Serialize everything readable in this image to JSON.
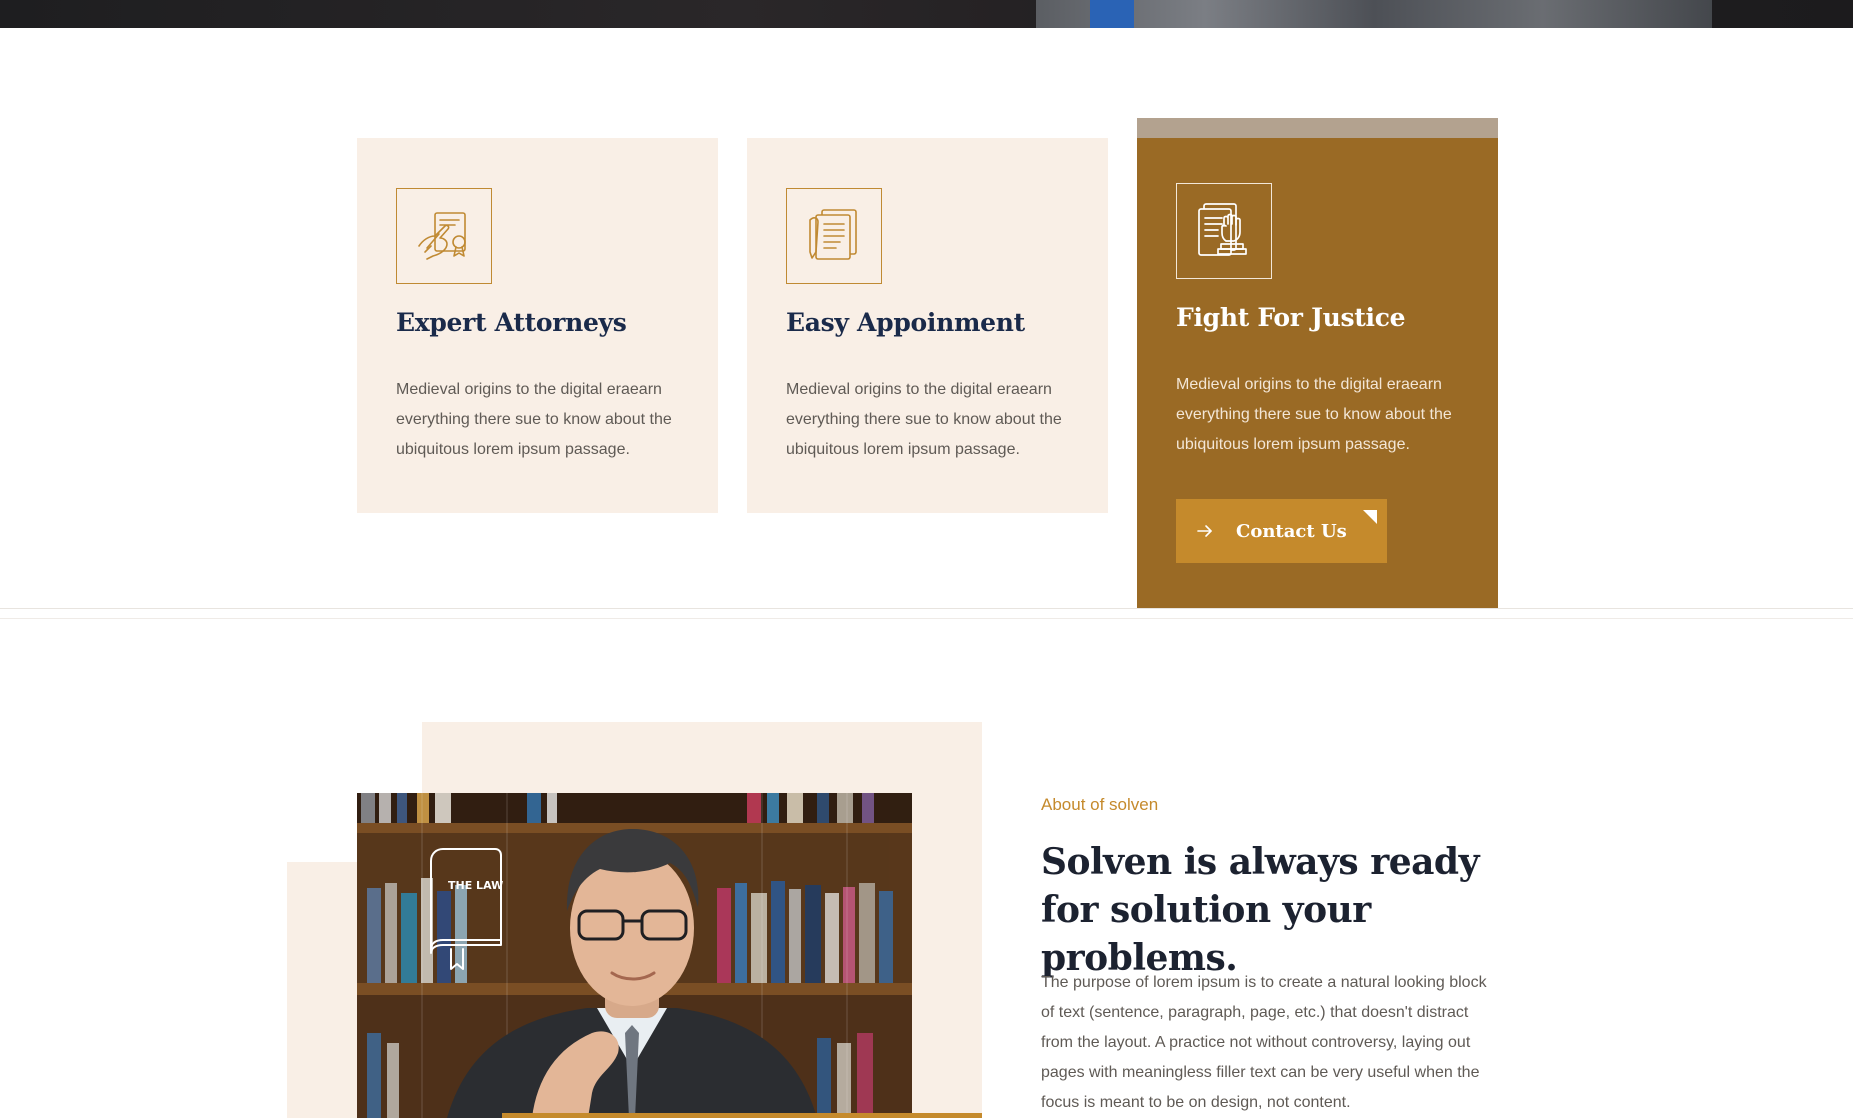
{
  "colors": {
    "accent": "#c58a2c",
    "card_bg": "#f9efe6",
    "card_active_bg": "#9a6a25",
    "heading_navy": "#1a2a4a"
  },
  "features": [
    {
      "icon": "signing-document-icon",
      "title": "Expert Attorneys",
      "text": "Medieval origins to the digital eraearn everything there sue to know about the ubiquitous lorem ipsum passage."
    },
    {
      "icon": "legal-papers-icon",
      "title": "Easy Appoinment",
      "text": "Medieval origins to the digital eraearn everything there sue to know about the ubiquitous lorem ipsum passage."
    },
    {
      "icon": "justice-fist-document-icon",
      "title": "Fight For Justice",
      "text": "Medieval origins to the digital eraearn everything there sue to know about the ubiquitous lorem ipsum passage.",
      "button_label": "Contact Us",
      "button_icon": "arrow-right-icon"
    }
  ],
  "about": {
    "eyebrow": "About of solven",
    "heading": "Solven is always ready for solution your problems.",
    "text": "The purpose of lorem ipsum is to create a natural looking block of text (sentence, paragraph, page, etc.) that doesn't distract from the layout. A practice not without controversy, laying out pages with meaningless filler text can be very useful when the focus is meant to be on design, not content.",
    "book_label": "THE LAW"
  }
}
